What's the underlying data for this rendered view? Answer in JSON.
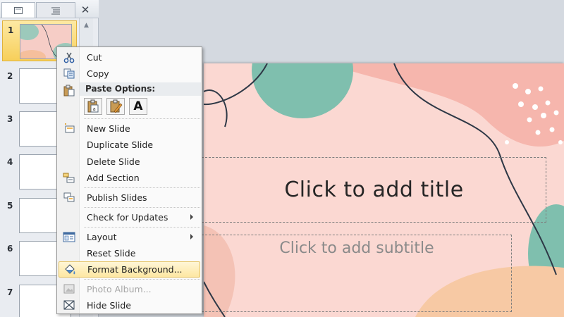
{
  "slides_pane": {
    "numbers": [
      "1",
      "2",
      "3",
      "4",
      "5",
      "6",
      "7"
    ],
    "selected_index": 0
  },
  "context_menu": {
    "cut": "Cut",
    "copy": "Copy",
    "paste_options": "Paste Options:",
    "new_slide": "New Slide",
    "duplicate_slide": "Duplicate Slide",
    "delete_slide": "Delete Slide",
    "add_section": "Add Section",
    "publish_slides": "Publish Slides",
    "check_for_updates": "Check for Updates",
    "layout": "Layout",
    "reset_slide": "Reset Slide",
    "format_background": "Format Background...",
    "photo_album": "Photo Album...",
    "hide_slide": "Hide Slide",
    "paste_keep_text_only": "A"
  },
  "slide": {
    "title_placeholder": "Click to add title",
    "subtitle_placeholder": "Click to add subtitle"
  },
  "colors": {
    "slide_background": "#fbd8d2",
    "teal": "#7fbfae",
    "peach": "#f7c9a4",
    "coral": "#f6b1a8",
    "selection": "#f7cf5a"
  },
  "icons": {
    "pane_close": "close-icon",
    "scroll_up": "chevron-up-icon",
    "cut": "scissors-icon",
    "copy": "copy-icon",
    "paste": "clipboard-icon",
    "new_slide": "new-slide-icon",
    "add_section": "section-icon",
    "publish_slides": "publish-icon",
    "layout": "layout-icon",
    "format_background": "paint-bucket-icon",
    "photo_album": "photo-album-icon",
    "hide_slide": "hide-slide-icon"
  }
}
